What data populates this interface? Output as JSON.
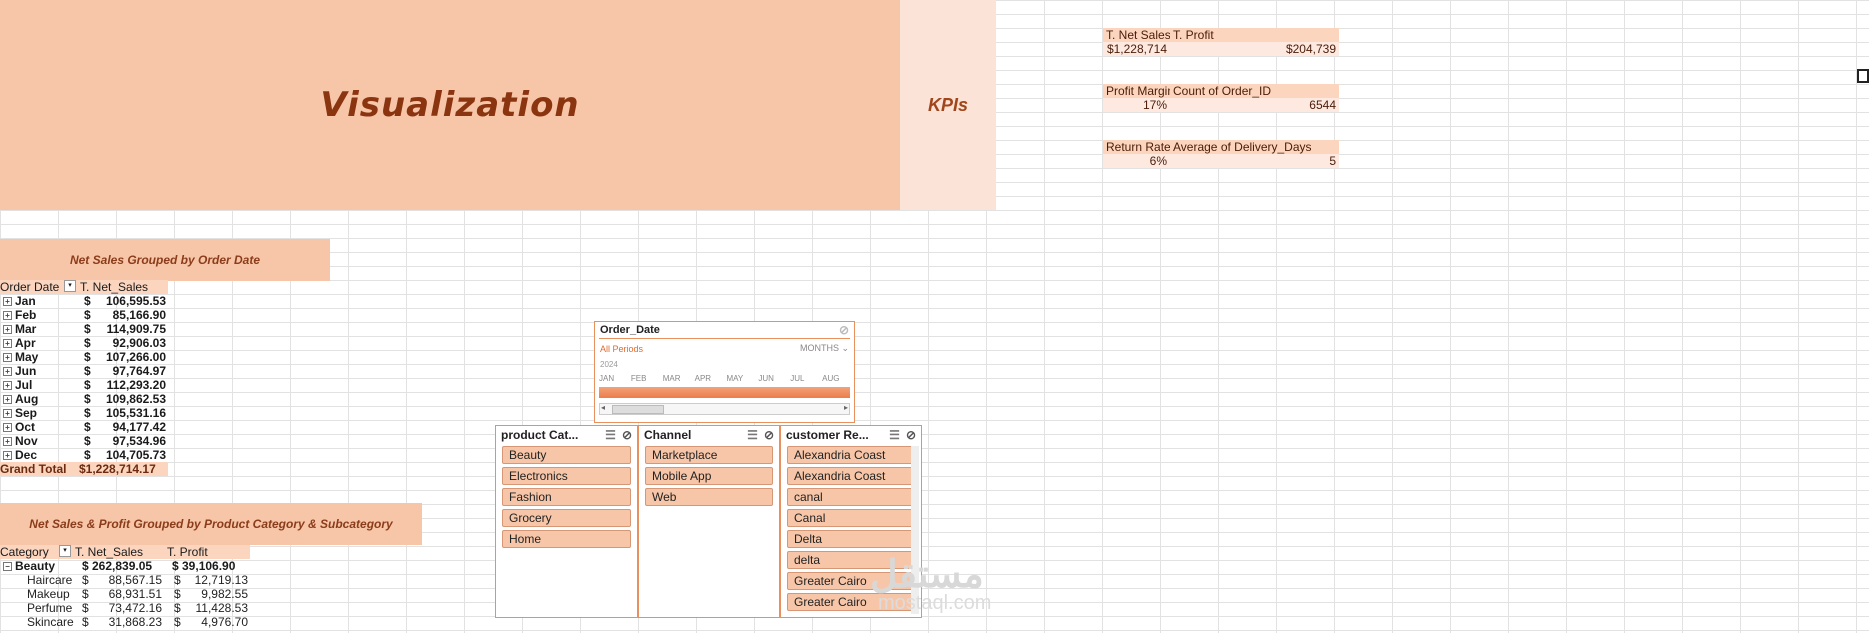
{
  "banner": {
    "title": "Visualization"
  },
  "kpi": {
    "title": "KPIs",
    "blocks": [
      {
        "h1": "T. Net Sales",
        "h2": "T. Profit",
        "v1": "$1,228,714",
        "v2": "$204,739"
      },
      {
        "h1": "Profit Margin",
        "h2": "Count of Order_ID",
        "v1": "17%",
        "v2": "6544"
      },
      {
        "h1": "Return Rate",
        "h2": "Average of Delivery_Days",
        "v1": "6%",
        "v2": "5"
      }
    ]
  },
  "net_sales_by_date": {
    "header": "Net Sales Grouped by Order Date",
    "col1": "Order Date",
    "col2": "T. Net_Sales",
    "rows": [
      {
        "month": "Jan",
        "currency": "$",
        "value": "106,595.53"
      },
      {
        "month": "Feb",
        "currency": "$",
        "value": "85,166.90"
      },
      {
        "month": "Mar",
        "currency": "$",
        "value": "114,909.75"
      },
      {
        "month": "Apr",
        "currency": "$",
        "value": "92,906.03"
      },
      {
        "month": "May",
        "currency": "$",
        "value": "107,266.00"
      },
      {
        "month": "Jun",
        "currency": "$",
        "value": "97,764.97"
      },
      {
        "month": "Jul",
        "currency": "$",
        "value": "112,293.20"
      },
      {
        "month": "Aug",
        "currency": "$",
        "value": "109,862.53"
      },
      {
        "month": "Sep",
        "currency": "$",
        "value": "105,531.16"
      },
      {
        "month": "Oct",
        "currency": "$",
        "value": "94,177.42"
      },
      {
        "month": "Nov",
        "currency": "$",
        "value": "97,534.96"
      },
      {
        "month": "Dec",
        "currency": "$",
        "value": "104,705.73"
      }
    ],
    "total_label": "Grand Total",
    "total_value": "$1,228,714.17"
  },
  "category_pivot": {
    "header": "Net Sales & Profit Grouped by Product Category & Subcategory",
    "col1": "Category",
    "col2": "T. Net_Sales",
    "col3": "T. Profit",
    "category": {
      "name": "Beauty",
      "sales": "$ 262,839.05",
      "profit": "$ 39,106.90"
    },
    "subs": [
      {
        "name": "Haircare",
        "sales": "88,567.15",
        "profit": "12,719.13"
      },
      {
        "name": "Makeup",
        "sales": "68,931.51",
        "profit": "9,982.55"
      },
      {
        "name": "Perfume",
        "sales": "73,472.16",
        "profit": "11,428.53"
      },
      {
        "name": "Skincare",
        "sales": "31,868.23",
        "profit": "4,976.70"
      }
    ],
    "currency": "$"
  },
  "timeline": {
    "title": "Order_Date",
    "period": "All Periods",
    "level": "MONTHS",
    "year": "2024",
    "months": [
      "JAN",
      "FEB",
      "MAR",
      "APR",
      "MAY",
      "JUN",
      "JUL",
      "AUG"
    ]
  },
  "slicers": [
    {
      "title": "product Cat...",
      "items": [
        "Beauty",
        "Electronics",
        "Fashion",
        "Grocery",
        "Home"
      ]
    },
    {
      "title": "Channel",
      "items": [
        "Marketplace",
        "Mobile App",
        "Web"
      ]
    },
    {
      "title": "customer Re...",
      "items": [
        "Alexandria Coast",
        "Alexandria Coast",
        "canal",
        "Canal",
        "Delta",
        "delta",
        "Greater Cairo",
        "Greater Cairo"
      ]
    }
  ],
  "watermark": {
    "main": "مستقل",
    "sub": "mostaql.com"
  },
  "colors": {
    "accent": "#f7c6a8",
    "dark_text": "#8b3410",
    "border": "#e8915e"
  }
}
